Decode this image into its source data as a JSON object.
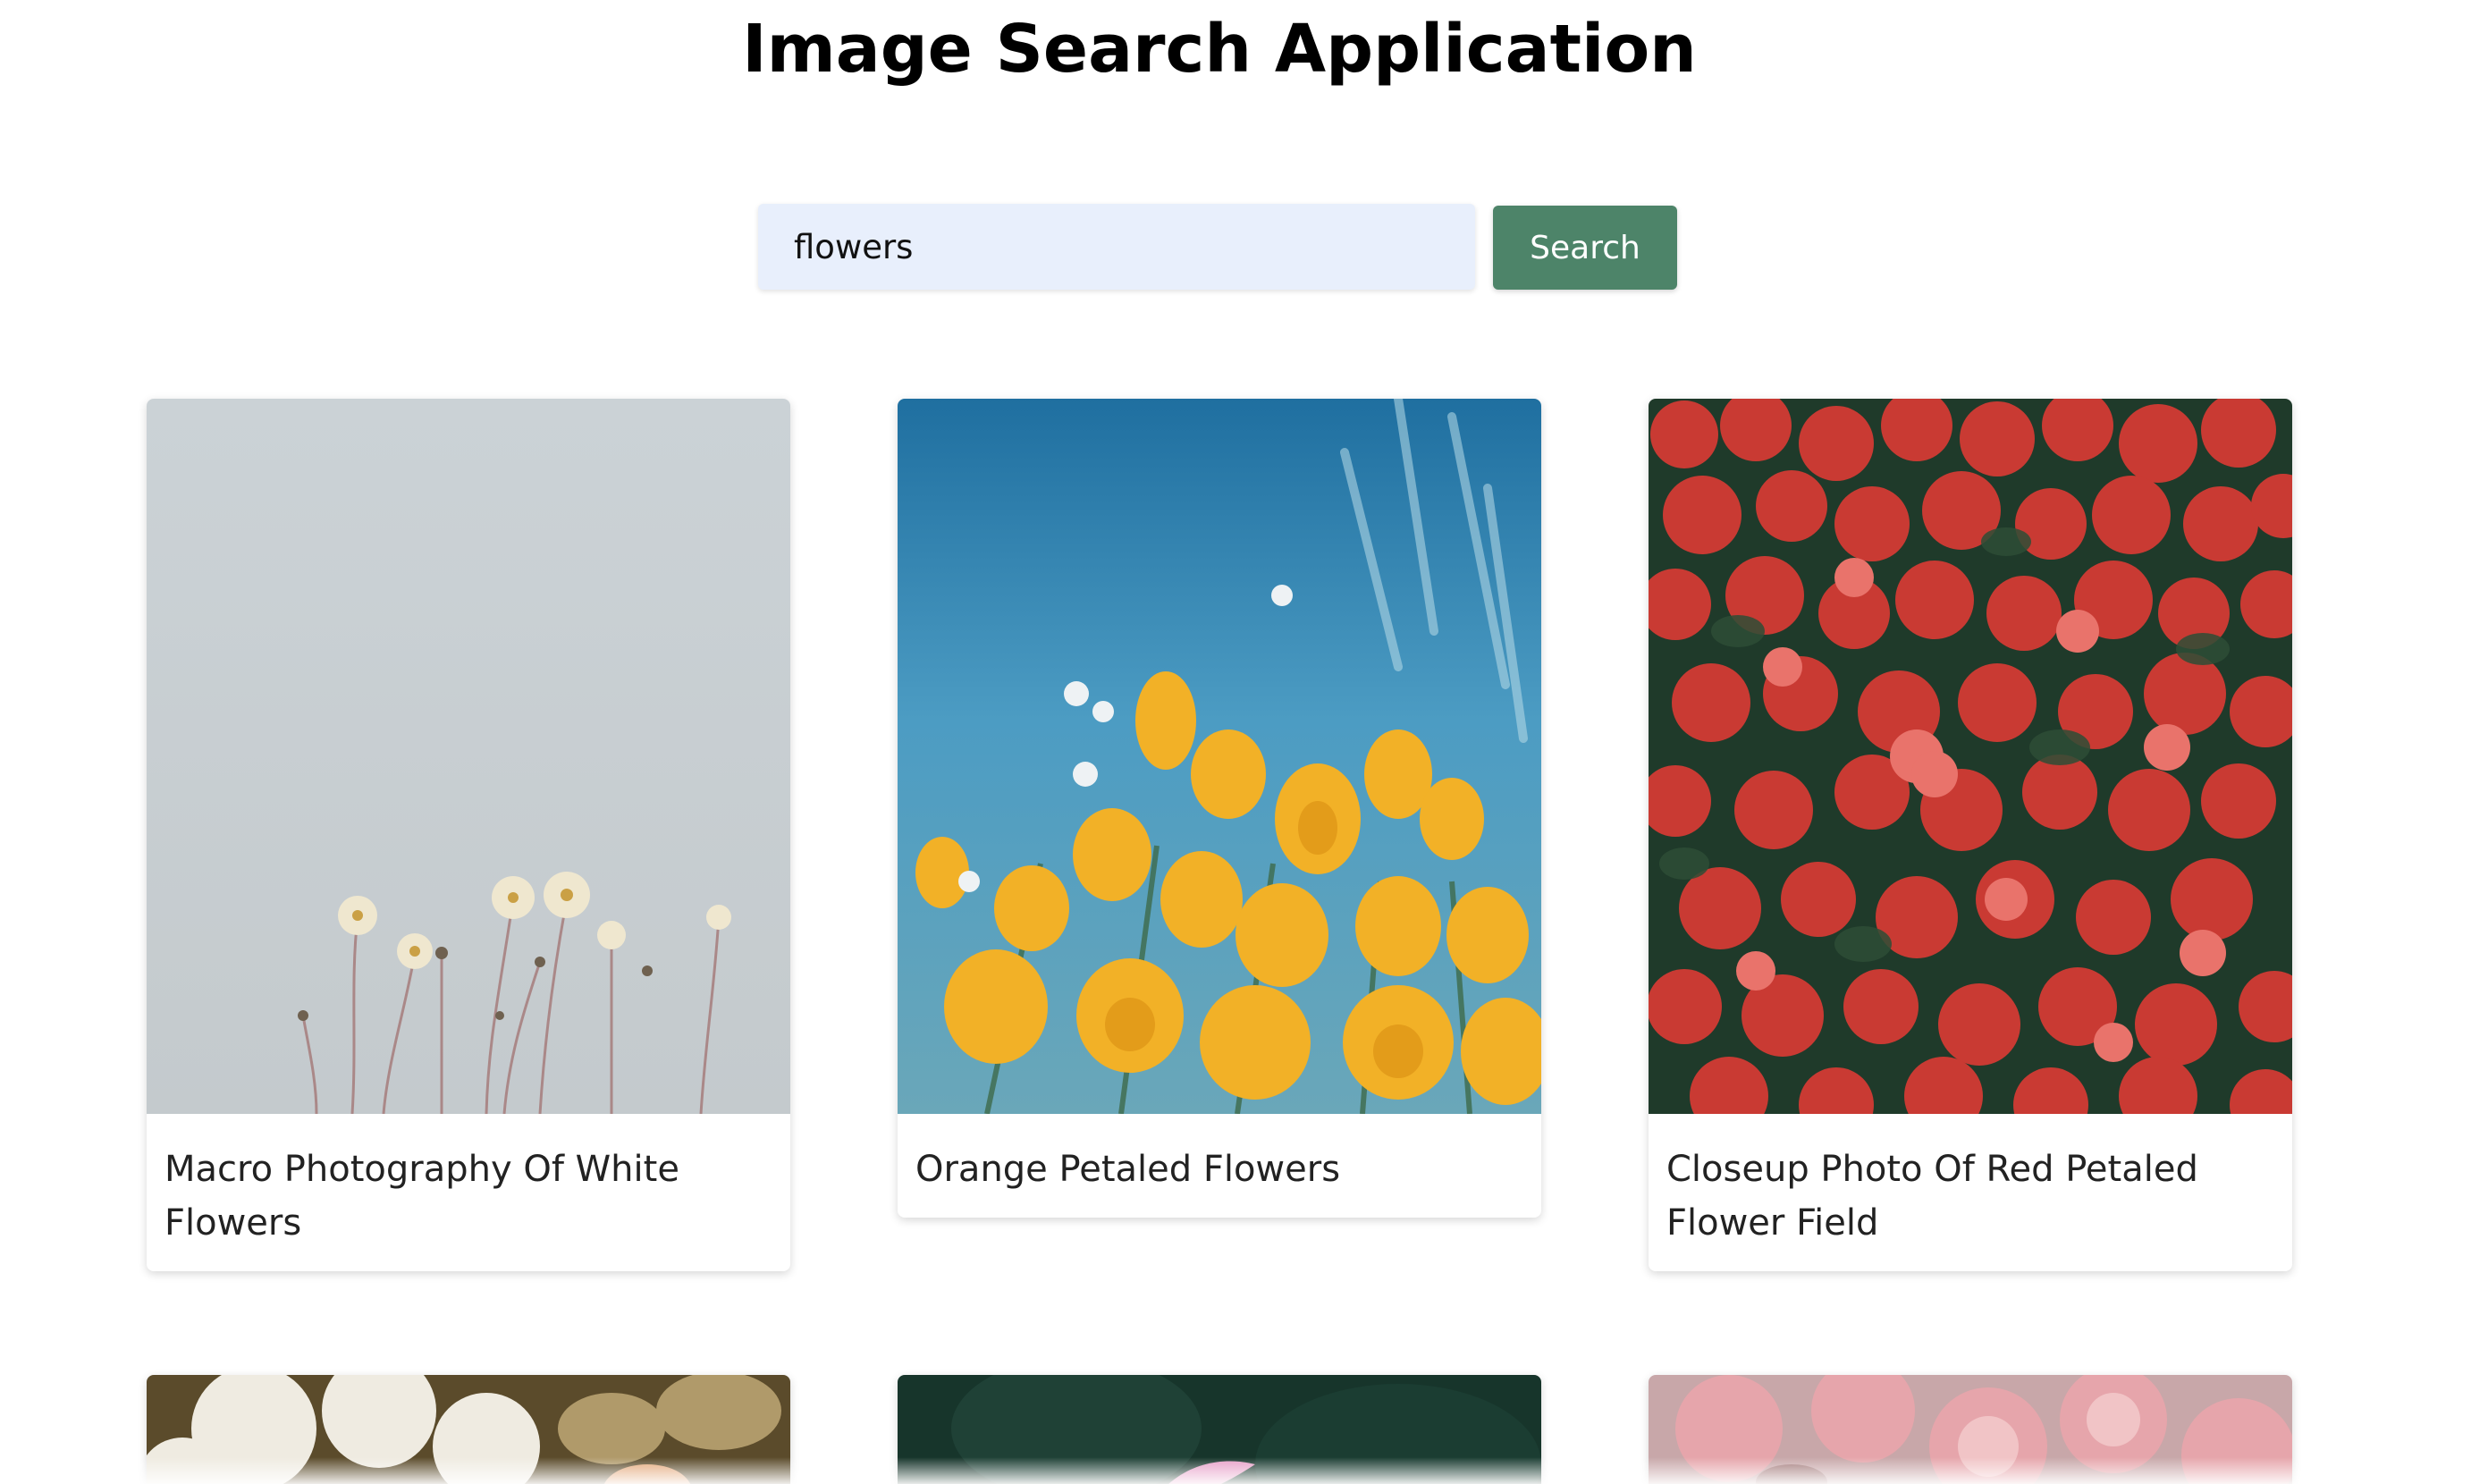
{
  "app": {
    "title": "Image Search Application"
  },
  "search": {
    "value": "flowers",
    "button_label": "Search"
  },
  "results": [
    {
      "caption": "Macro Photography Of White Flowers"
    },
    {
      "caption": "Orange Petaled Flowers"
    },
    {
      "caption": "Closeup Photo Of Red Petaled Flower Field"
    }
  ],
  "colors": {
    "search_input_bg": "#e8effc",
    "search_button_bg": "#4d8469",
    "search_button_text": "#ffffff"
  }
}
